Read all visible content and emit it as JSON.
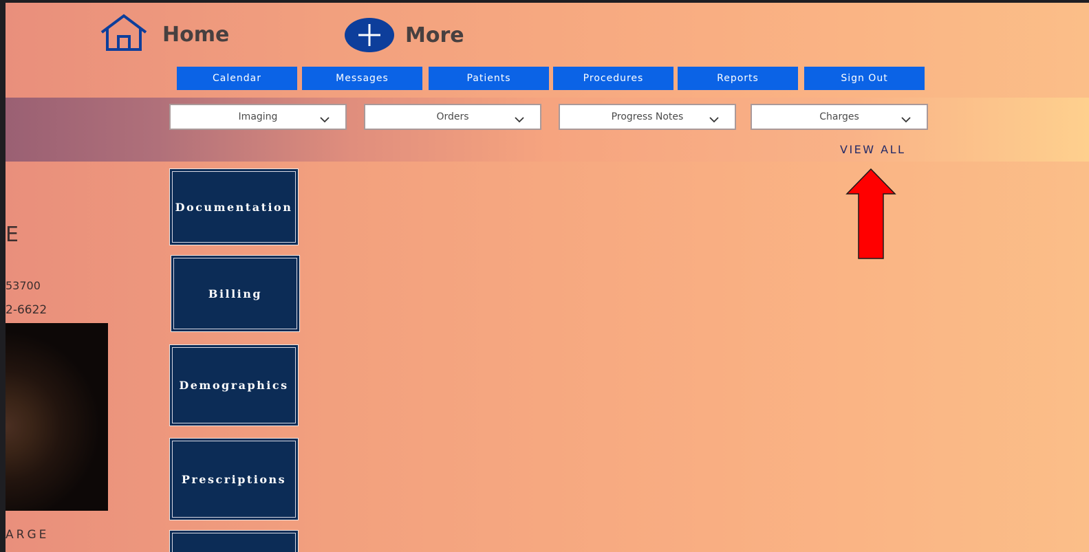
{
  "nav": {
    "home_label": "Home",
    "more_label": "More"
  },
  "menu": [
    {
      "label": "Calendar"
    },
    {
      "label": "Messages"
    },
    {
      "label": "Patients"
    },
    {
      "label": "Procedures"
    },
    {
      "label": "Reports"
    },
    {
      "label": "Sign Out"
    }
  ],
  "dropdowns": [
    {
      "label": "Imaging"
    },
    {
      "label": "Orders"
    },
    {
      "label": "Progress Notes"
    },
    {
      "label": "Charges"
    }
  ],
  "view_all": "VIEW ALL",
  "tiles": [
    {
      "label": "Documentation"
    },
    {
      "label": "Billing"
    },
    {
      "label": "Demographics"
    },
    {
      "label": "Prescriptions"
    }
  ],
  "side": {
    "glyph": "E",
    "line1": "53700",
    "line2": "2-6622",
    "footer": "ARGE"
  },
  "colors": {
    "menu_button": "#0b63e6",
    "tile_background": "#0c2c56",
    "home_icon": "#0d3e9b",
    "annotation_arrow": "#ff0000"
  }
}
